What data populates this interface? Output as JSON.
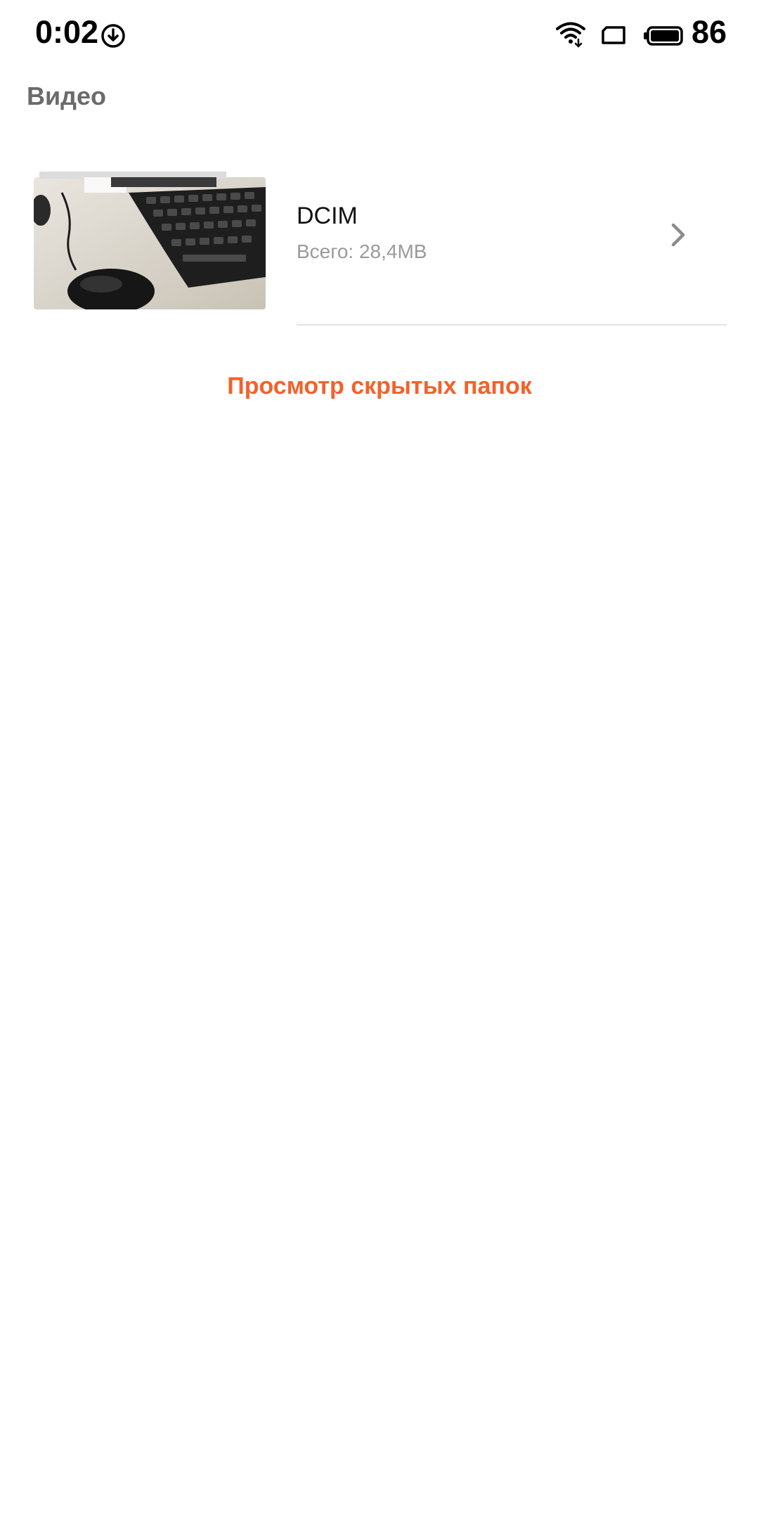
{
  "status_bar": {
    "time": "0:02",
    "battery_level": "86",
    "icons": [
      "download-icon",
      "wifi-icon",
      "screen-icon",
      "battery-icon"
    ]
  },
  "header": {
    "title": "Видео"
  },
  "folders": [
    {
      "name": "DCIM",
      "size_text": "Всего: 28,4MB",
      "thumbnail": "keyboard-and-mouse-photo"
    }
  ],
  "actions": {
    "view_hidden_label": "Просмотр скрытых папок"
  },
  "colors": {
    "accent": "#f2622c",
    "title": "#6b6b6b",
    "secondary_text": "#9a9a9a",
    "divider": "#e2e2e2"
  }
}
